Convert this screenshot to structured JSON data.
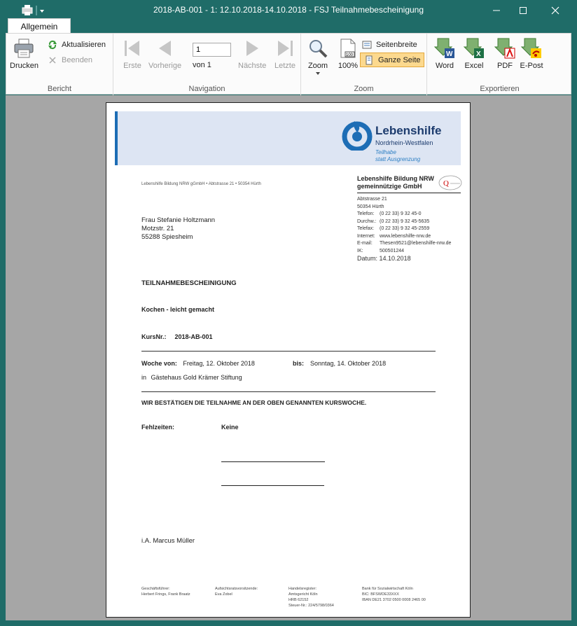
{
  "window": {
    "title": "2018-AB-001 - 1: 12.10.2018-14.10.2018 - FSJ Teilnahmebescheinigung",
    "minimize": "—",
    "maximize": "☐",
    "close": "✕"
  },
  "ribbon": {
    "tab": "Allgemein",
    "bericht": {
      "label": "Bericht",
      "print": "Drucken",
      "refresh": "Aktualisieren",
      "end": "Beenden"
    },
    "navigation": {
      "label": "Navigation",
      "first": "Erste",
      "prev": "Vorherige",
      "page_value": "1",
      "of": "von 1",
      "next": "Nächste",
      "last": "Letzte"
    },
    "zoom": {
      "label": "Zoom",
      "zoom": "Zoom",
      "hundred": "100%",
      "page_width": "Seitenbreite",
      "whole_page": "Ganze Seite"
    },
    "export": {
      "label": "Exportieren",
      "word": "Word",
      "excel": "Excel",
      "pdf": "PDF",
      "epost": "E-Post"
    }
  },
  "doc": {
    "logo": {
      "name": "Lebenshilfe",
      "sub": "Nordrhein-Westfalen",
      "tag1": "Teilhabe",
      "tag2": "statt Ausgrenzung"
    },
    "sender_line": "Lebenshilfe Bildung NRW gGmbH • Abtstrasse 21 • 50354 Hürth",
    "org": {
      "name1": "Lebenshilfe Bildung NRW",
      "name2": "gemeinnützige GmbH",
      "street": "Abtstrasse 21",
      "city": "50354 Hürth",
      "rows": [
        {
          "k": "Telefon:",
          "v": "(0 22 33) 9 32 45-0"
        },
        {
          "k": "Durchw.:",
          "v": "(0 22 33) 9 32 45-5635"
        },
        {
          "k": "Telefax:",
          "v": "(0 22 33) 9 32 45-2559"
        },
        {
          "k": "Internet:",
          "v": "www.lebenshilfe-nrw.de"
        },
        {
          "k": "E-mail:",
          "v": "Thesen9521@lebenshilfe-nrw.de"
        },
        {
          "k": "IK:",
          "v": "500501244"
        }
      ],
      "datum_label": "Datum:",
      "datum_value": "14.10.2018"
    },
    "recipient": [
      "Frau Stefanie Holtzmann",
      "Motzstr. 21",
      "55288 Spiesheim"
    ],
    "title": "TEILNAHMEBESCHEINIGUNG",
    "course": "Kochen - leicht gemacht",
    "kurs_label": "KursNr.:",
    "kurs_value": "2018-AB-001",
    "week_label": "Woche von:",
    "week_from": "Freitag, 12. Oktober 2018",
    "week_to_label": "bis:",
    "week_to": "Sonntag, 14. Oktober 2018",
    "location_prefix": "in",
    "location": "Gästehaus Gold Krämer Stiftung",
    "confirm": "WIR BESTÄTIGEN DIE TEILNAHME AN DER OBEN GENANNTEN KURSWOCHE.",
    "fehl_label": "Fehlzeiten:",
    "fehl_value": "Keine",
    "signature": "i.A. Marcus Müller",
    "footer": [
      [
        "Geschäftsführer:",
        "Herbert Frings, Frank Braatz"
      ],
      [
        "Aufsichtsratsvorsitzende:",
        "Eva Zobel"
      ],
      [
        "Handelsregister:",
        "Amtsgericht Köln",
        "HRB 62152",
        "Steuer-Nr.: 224/5798/0364"
      ],
      [
        "Bank für Sozialwirtschaft Köln",
        "BIC: BFSWDE33XXX",
        "IBAN DE21 3702 0500 0008 2465 00"
      ]
    ]
  }
}
